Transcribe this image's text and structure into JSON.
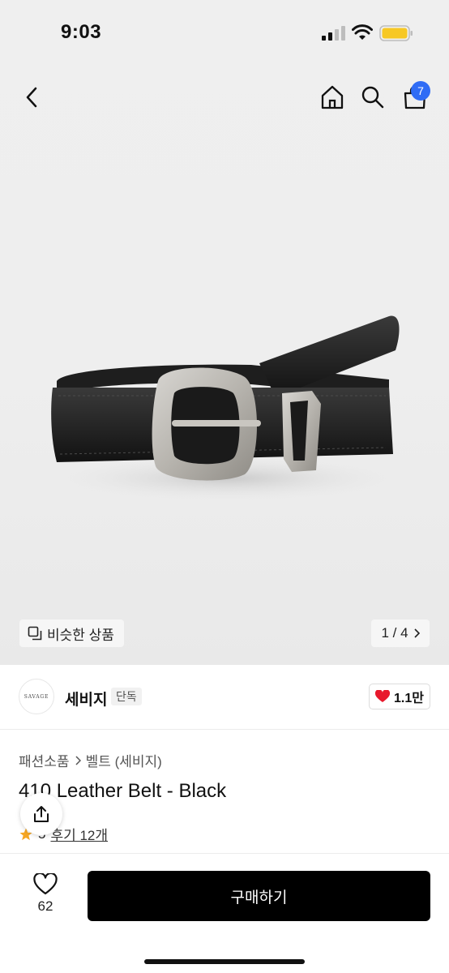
{
  "status_bar": {
    "time": "9:03"
  },
  "nav": {
    "cart_count": "7"
  },
  "gallery": {
    "similar_label": "비슷한 상품",
    "pager": "1 / 4"
  },
  "brand": {
    "logo_text": "SAVAGE",
    "name": "세비지",
    "tag": "단독",
    "likes": "1.1만"
  },
  "product": {
    "breadcrumb": [
      "패션소품",
      "벨트 (세비지)"
    ],
    "title": "410 Leather Belt - Black",
    "rating": "5",
    "reviews": "후기 12개"
  },
  "bottom_bar": {
    "wish_count": "62",
    "buy_label": "구매하기"
  },
  "colors": {
    "badge": "#2f6cf5",
    "heart": "#e8192c",
    "star": "#f5a623",
    "buy_button": "#000000"
  },
  "icons": [
    "back-icon",
    "home-icon",
    "search-icon",
    "cart-icon",
    "similar-icon",
    "chevron-right-icon",
    "heart-icon",
    "share-icon",
    "star-icon"
  ]
}
